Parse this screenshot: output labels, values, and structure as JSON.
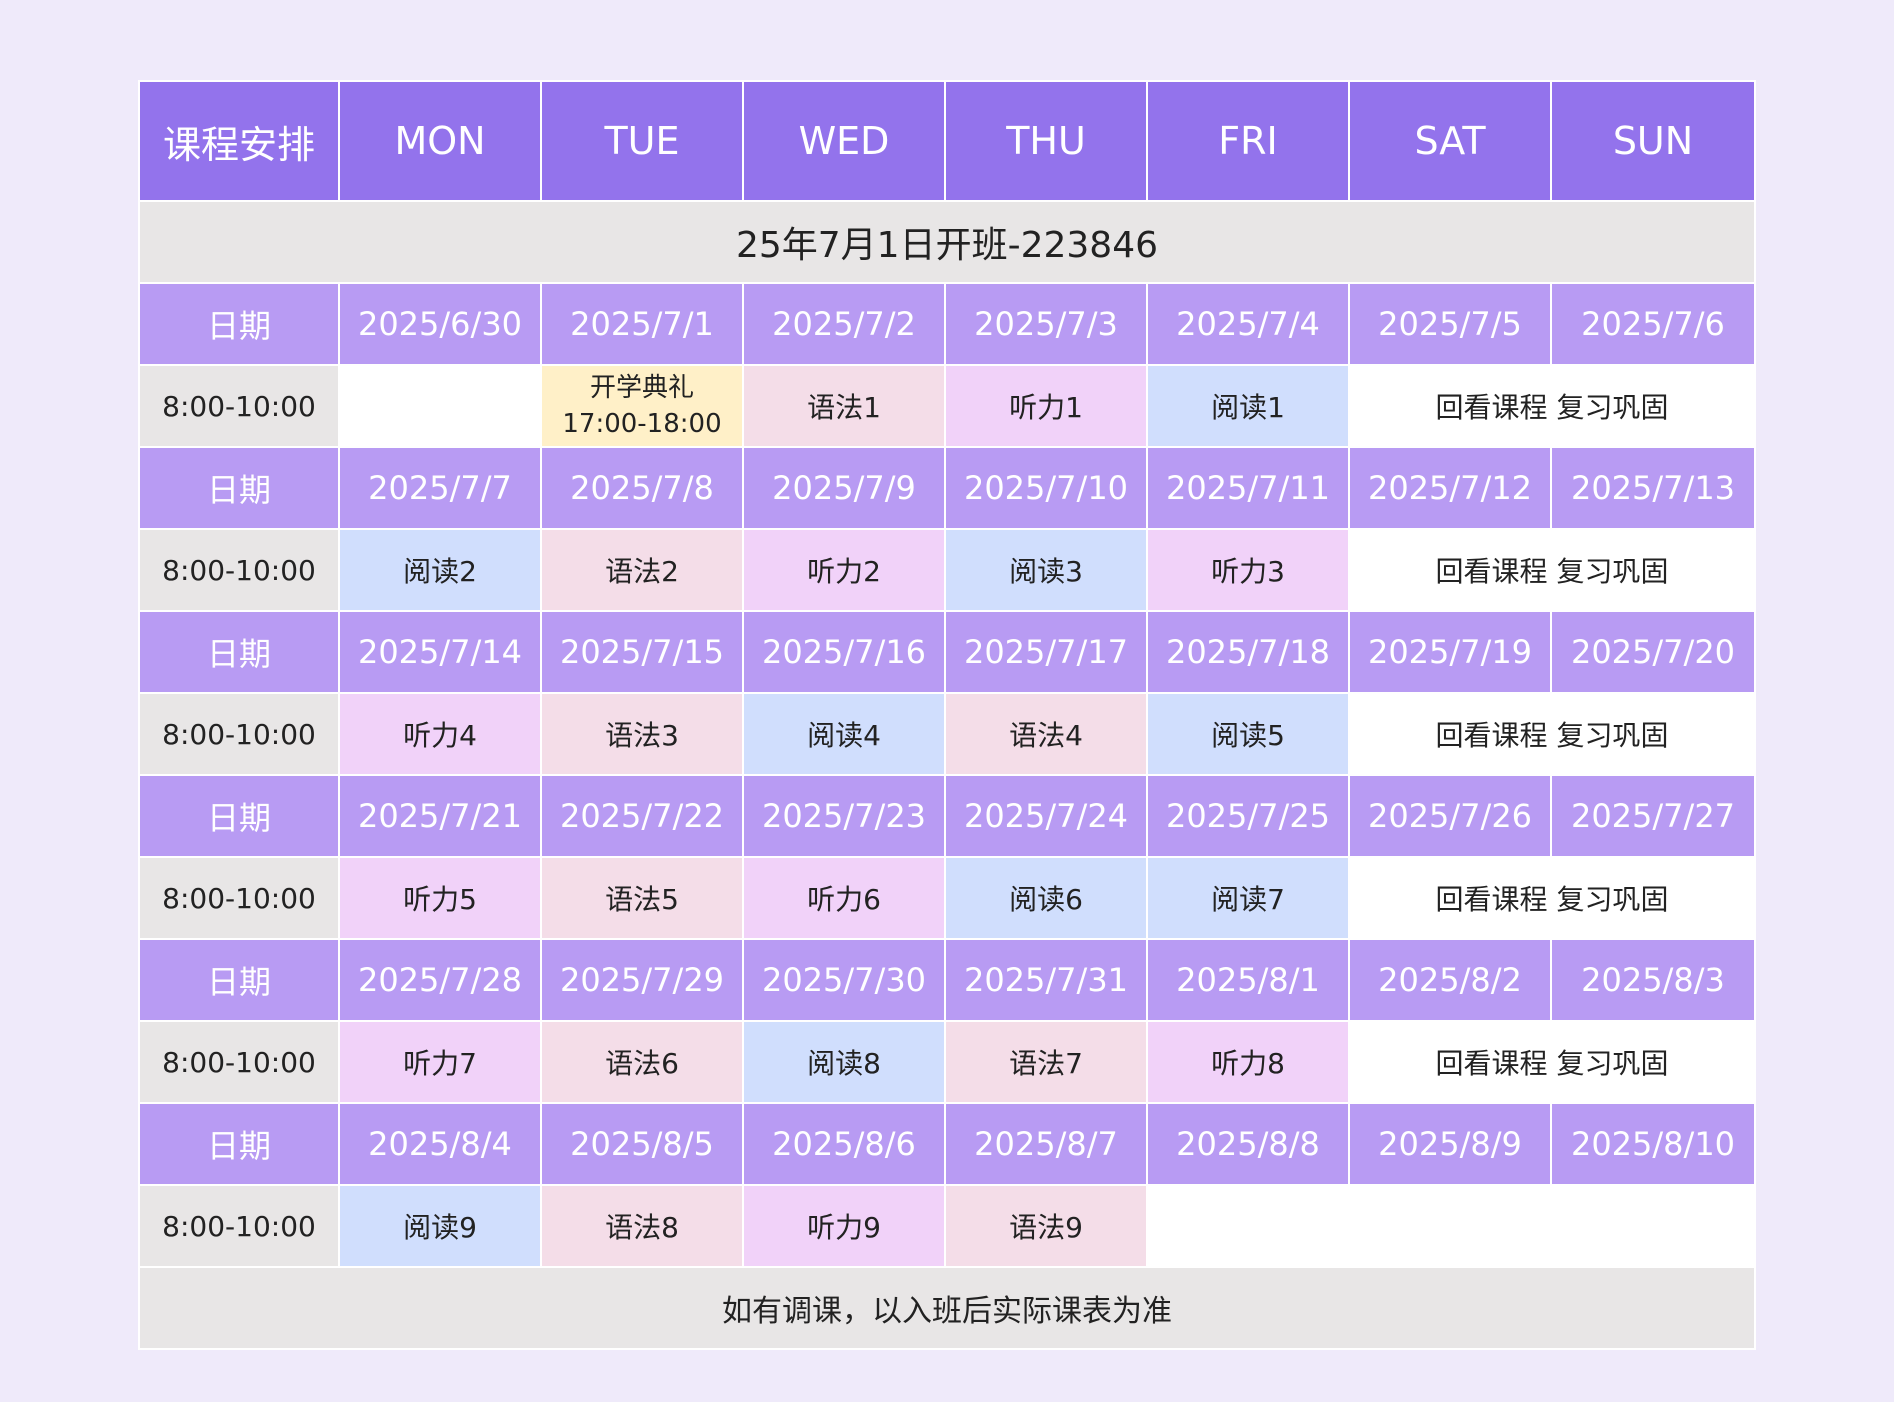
{
  "corner_label": "课程安排",
  "days": [
    "MON",
    "TUE",
    "WED",
    "THU",
    "FRI",
    "SAT",
    "SUN"
  ],
  "class_title": "25年7月1日开班-223846",
  "date_label": "日期",
  "time_label": "8:00-10:00",
  "weekend_label": "回看课程 复习巩固",
  "footer_note": "如有调课，以入班后实际课表为准",
  "colors": {
    "header": "#9373ec",
    "date_row": "#b89bf3",
    "gray": "#e8e6e6",
    "ceremony": "#fff0c8",
    "grammar": "#f4dde8",
    "listening": "#f1d2f9",
    "reading": "#d0defd",
    "background": "#efeafa"
  },
  "weeks": [
    {
      "dates": [
        "2025/6/30",
        "2025/7/1",
        "2025/7/2",
        "2025/7/3",
        "2025/7/4",
        "2025/7/5",
        "2025/7/6"
      ],
      "sessions": [
        {
          "text": "",
          "kind": "empty"
        },
        {
          "text": "开学典礼\n17:00-18:00",
          "kind": "ceremony"
        },
        {
          "text": "语法1",
          "kind": "grammar"
        },
        {
          "text": "听力1",
          "kind": "listening"
        },
        {
          "text": "阅读1",
          "kind": "reading"
        }
      ],
      "weekend": true
    },
    {
      "dates": [
        "2025/7/7",
        "2025/7/8",
        "2025/7/9",
        "2025/7/10",
        "2025/7/11",
        "2025/7/12",
        "2025/7/13"
      ],
      "sessions": [
        {
          "text": "阅读2",
          "kind": "reading"
        },
        {
          "text": "语法2",
          "kind": "grammar"
        },
        {
          "text": "听力2",
          "kind": "listening"
        },
        {
          "text": "阅读3",
          "kind": "reading"
        },
        {
          "text": "听力3",
          "kind": "listening"
        }
      ],
      "weekend": true
    },
    {
      "dates": [
        "2025/7/14",
        "2025/7/15",
        "2025/7/16",
        "2025/7/17",
        "2025/7/18",
        "2025/7/19",
        "2025/7/20"
      ],
      "sessions": [
        {
          "text": "听力4",
          "kind": "listening"
        },
        {
          "text": "语法3",
          "kind": "grammar"
        },
        {
          "text": "阅读4",
          "kind": "reading"
        },
        {
          "text": "语法4",
          "kind": "grammar"
        },
        {
          "text": "阅读5",
          "kind": "reading"
        }
      ],
      "weekend": true
    },
    {
      "dates": [
        "2025/7/21",
        "2025/7/22",
        "2025/7/23",
        "2025/7/24",
        "2025/7/25",
        "2025/7/26",
        "2025/7/27"
      ],
      "sessions": [
        {
          "text": "听力5",
          "kind": "listening"
        },
        {
          "text": "语法5",
          "kind": "grammar"
        },
        {
          "text": "听力6",
          "kind": "listening"
        },
        {
          "text": "阅读6",
          "kind": "reading"
        },
        {
          "text": "阅读7",
          "kind": "reading"
        }
      ],
      "weekend": true
    },
    {
      "dates": [
        "2025/7/28",
        "2025/7/29",
        "2025/7/30",
        "2025/7/31",
        "2025/8/1",
        "2025/8/2",
        "2025/8/3"
      ],
      "sessions": [
        {
          "text": "听力7",
          "kind": "listening"
        },
        {
          "text": "语法6",
          "kind": "grammar"
        },
        {
          "text": "阅读8",
          "kind": "reading"
        },
        {
          "text": "语法7",
          "kind": "grammar"
        },
        {
          "text": "听力8",
          "kind": "listening"
        }
      ],
      "weekend": true
    },
    {
      "dates": [
        "2025/8/4",
        "2025/8/5",
        "2025/8/6",
        "2025/8/7",
        "2025/8/8",
        "2025/8/9",
        "2025/8/10"
      ],
      "sessions": [
        {
          "text": "阅读9",
          "kind": "reading"
        },
        {
          "text": "语法8",
          "kind": "grammar"
        },
        {
          "text": "听力9",
          "kind": "listening"
        },
        {
          "text": "语法9",
          "kind": "grammar"
        }
      ],
      "weekend": false
    }
  ]
}
